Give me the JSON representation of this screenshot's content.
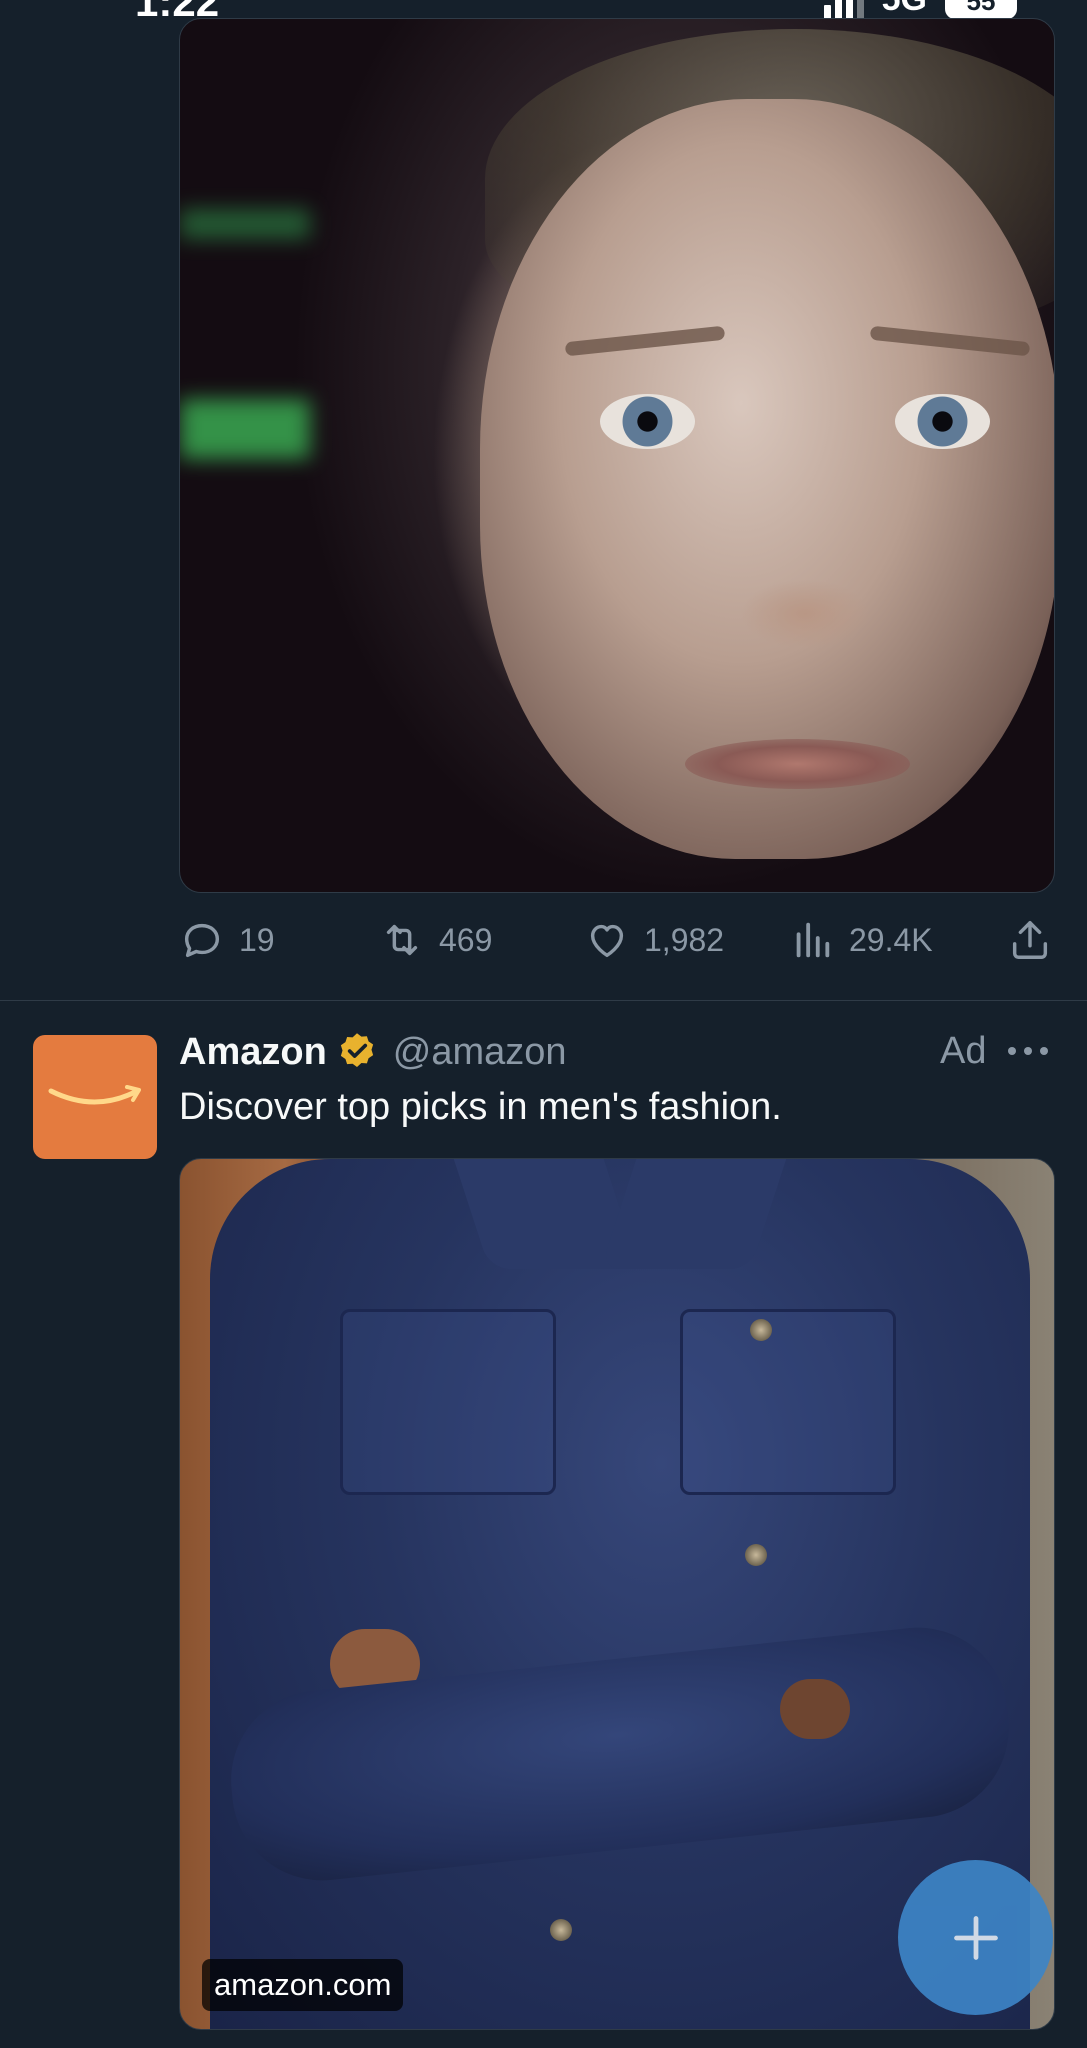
{
  "status_bar": {
    "time": "1:22",
    "network": "5G",
    "battery": "55"
  },
  "tweet_1": {
    "stats": {
      "replies": "19",
      "retweets": "469",
      "likes": "1,982",
      "views": "29.4K"
    }
  },
  "tweet_2": {
    "display_name": "Amazon",
    "handle": "@amazon",
    "ad_label": "Ad",
    "text": "Discover top picks in men's fashion.",
    "media_source": "amazon.com"
  },
  "colors": {
    "background": "#15202b",
    "muted_text": "#8b98a5",
    "avatar_orange": "#e47b3f",
    "verified_gold": "#e8b22e",
    "fab_blue": "#3d84c6"
  },
  "icons": {
    "reply": "reply-icon",
    "retweet": "retweet-icon",
    "like": "heart-icon",
    "views": "views-icon",
    "share": "share-icon",
    "verified": "verified-badge-icon",
    "more": "more-icon",
    "compose": "plus-icon"
  }
}
